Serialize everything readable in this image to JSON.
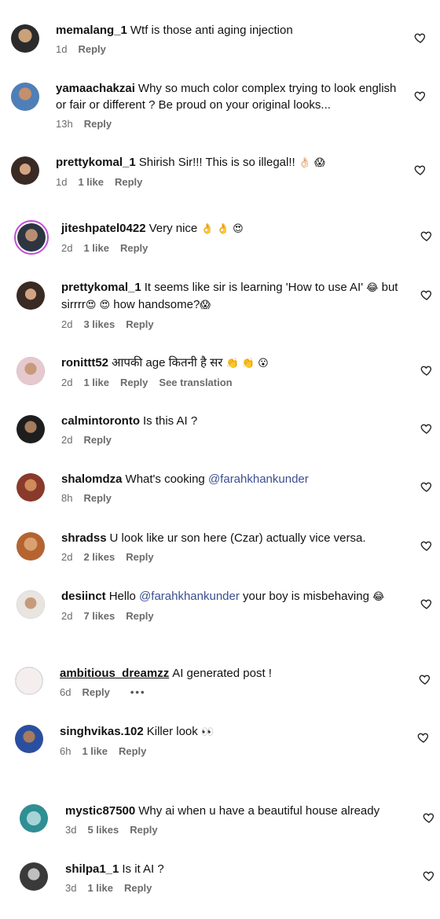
{
  "comments": [
    {
      "username": "memalang_1",
      "text": "Wtf is those anti aging injection",
      "time": "1d",
      "likes": "",
      "reply": "Reply"
    },
    {
      "username": "yamaachakzai",
      "text": "Why so much color complex trying to look english or fair or different ? Be proud on your original looks...",
      "time": "13h",
      "likes": "",
      "reply": "Reply"
    },
    {
      "username": "prettykomal_1",
      "text": "Shirish Sir!!! This is so illegal!!",
      "emoji": "👌🏻 😱",
      "time": "1d",
      "likes": "1 like",
      "reply": "Reply"
    },
    {
      "username": "jiteshpatel0422",
      "text": "Very nice",
      "emoji": "👌 👌 😍",
      "time": "2d",
      "likes": "1 like",
      "reply": "Reply"
    },
    {
      "username": "prettykomal_1",
      "text": "It seems like sir is learning 'How to use AI'",
      "emoji": "😂",
      "text2": "but sirrrr",
      "emoji2": "😍 😍",
      "text3": "how handsome?",
      "emoji3": "😱",
      "time": "2d",
      "likes": "3 likes",
      "reply": "Reply"
    },
    {
      "username": "ronittt52",
      "text": "आपकी age कितनी है सर",
      "emoji": "👏 👏 😮",
      "time": "2d",
      "likes": "1 like",
      "reply": "Reply",
      "translation": "See translation"
    },
    {
      "username": "calmintoronto",
      "text": "Is this AI ?",
      "time": "2d",
      "likes": "",
      "reply": "Reply"
    },
    {
      "username": "shalomdza",
      "text": "What's cooking",
      "mention": "@farahkhankunder",
      "time": "8h",
      "likes": "",
      "reply": "Reply"
    },
    {
      "username": "shradss",
      "text": "U look like ur son here (Czar) actually vice versa.",
      "time": "2d",
      "likes": "2 likes",
      "reply": "Reply"
    },
    {
      "username": "desiinct",
      "text": "Hello",
      "mention": "@farahkhankunder",
      "text_after": "your boy is misbehaving",
      "emoji": "😂",
      "time": "2d",
      "likes": "7 likes",
      "reply": "Reply"
    },
    {
      "username": "ambitious_dreamzz",
      "text": "AI generated post !",
      "time": "6d",
      "likes": "",
      "reply": "Reply",
      "more": "•••"
    },
    {
      "username": "singhvikas.102",
      "text": "Killer look",
      "emoji": "👀",
      "time": "6h",
      "likes": "1 like",
      "reply": "Reply"
    },
    {
      "username": "mystic87500",
      "text": "Why ai when u have a beautiful house already",
      "time": "3d",
      "likes": "5 likes",
      "reply": "Reply"
    },
    {
      "username": "shilpa1_1",
      "text": "Is it AI ?",
      "time": "3d",
      "likes": "1 like",
      "reply": "Reply"
    }
  ],
  "colors": {
    "avatar_ring": "#c34bd8",
    "mention": "#3b4f8f",
    "meta": "#6b6b6b"
  },
  "icons": {
    "like": "heart-icon"
  }
}
